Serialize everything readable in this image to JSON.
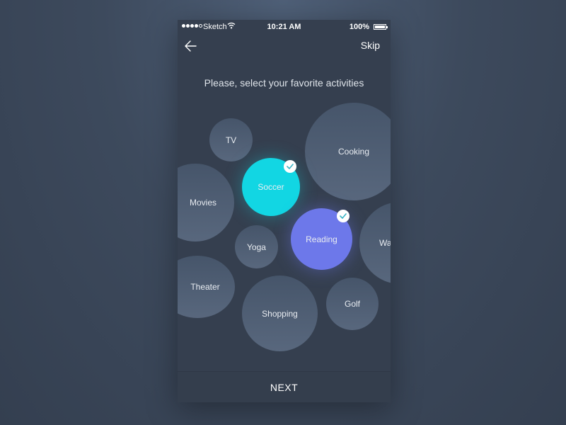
{
  "status_bar": {
    "carrier": "Sketch",
    "time": "10:21 AM",
    "battery": "100%",
    "signal_icon": "signal-dots-icon",
    "wifi_icon": "wifi-icon",
    "battery_icon": "battery-icon"
  },
  "nav": {
    "back_icon": "arrow-left-icon",
    "skip_label": "Skip"
  },
  "prompt": "Please, select your favorite activities",
  "activities": [
    {
      "label": "TV",
      "selected": false
    },
    {
      "label": "Cooking",
      "selected": false
    },
    {
      "label": "Soccer",
      "selected": true
    },
    {
      "label": "Movies",
      "selected": false
    },
    {
      "label": "Reading",
      "selected": true
    },
    {
      "label": "Wa",
      "selected": false
    },
    {
      "label": "Yoga",
      "selected": false
    },
    {
      "label": "Theater",
      "selected": false
    },
    {
      "label": "Shopping",
      "selected": false
    },
    {
      "label": "Golf",
      "selected": false
    }
  ],
  "check_icon": "checkmark-icon",
  "next_label": "NEXT",
  "colors": {
    "selected_soccer": "#12d6e3",
    "selected_reading": "#6d78ea",
    "check_mark": "#3ab5c6",
    "background": "#353f4f"
  }
}
